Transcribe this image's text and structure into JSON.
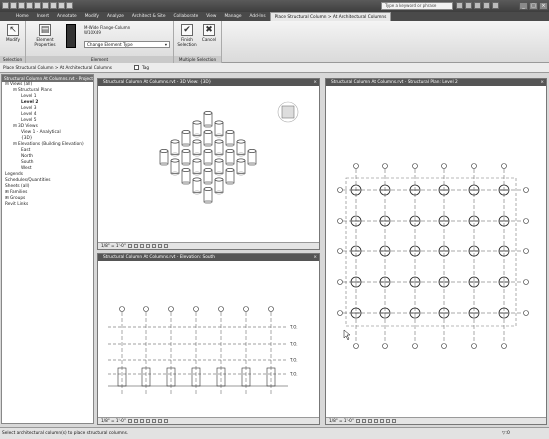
{
  "search": {
    "placeholder": "Type a keyword or phrase"
  },
  "tabs": [
    "Home",
    "Insert",
    "Annotate",
    "Modify",
    "Analyze",
    "Architect & Site",
    "Collaborate",
    "View",
    "Manage",
    "Add-Ins",
    "Place Structural Column > At Architectural Columns"
  ],
  "ribbon": {
    "modify": "Modify",
    "element_properties": "Element Properties",
    "type_line1": "M-Wide Flange-Column",
    "type_line2": "W10X49",
    "change_type": "Change Element Type",
    "finish": "Finish Selection",
    "cancel": "Cancel",
    "panel_selection": "Selection",
    "panel_element": "Element",
    "panel_multiple": "Multiple Selection"
  },
  "options": {
    "context": "Place Structural Column > At Architectural Columns",
    "tag": "Tag"
  },
  "browser": {
    "title": "Structural Column At Columns.rvt - Project Browser",
    "items": [
      {
        "t": "⊟ Views (all)",
        "d": 0
      },
      {
        "t": "⊟ Structural Plans",
        "d": 1
      },
      {
        "t": "Level 1",
        "d": 2
      },
      {
        "t": "Level 2",
        "d": 2,
        "b": true
      },
      {
        "t": "Level 3",
        "d": 2
      },
      {
        "t": "Level 4",
        "d": 2
      },
      {
        "t": "Level 5",
        "d": 2
      },
      {
        "t": "⊟ 3D Views",
        "d": 1
      },
      {
        "t": "View 1 - Analytical",
        "d": 2
      },
      {
        "t": "{3D}",
        "d": 2
      },
      {
        "t": "⊟ Elevations (Building Elevation)",
        "d": 1
      },
      {
        "t": "East",
        "d": 2
      },
      {
        "t": "North",
        "d": 2
      },
      {
        "t": "South",
        "d": 2
      },
      {
        "t": "West",
        "d": 2
      },
      {
        "t": "Legends",
        "d": 0
      },
      {
        "t": "Schedules/Quantities",
        "d": 0
      },
      {
        "t": "Sheets (all)",
        "d": 0
      },
      {
        "t": "⊞ Families",
        "d": 0
      },
      {
        "t": "⊞ Groups",
        "d": 0
      },
      {
        "t": "Revit Links",
        "d": 0
      }
    ]
  },
  "views": {
    "view3d_title": "Structural Column At Columns.rvt - 3D View: {3D}",
    "elev_title": "Structural Column At Columns.rvt - Elevation: South",
    "plan_title": "Structural Column At Columns.rvt - Structural Plan: Level 2",
    "scale": "1/8\" = 1'-0\"",
    "level_tags": [
      "T.O. ",
      "T.O. ",
      "T.O. ",
      "T.O. "
    ]
  },
  "status": {
    "text": "Select architectural column(s) to place structural columns.",
    "filter": "▽:0"
  }
}
